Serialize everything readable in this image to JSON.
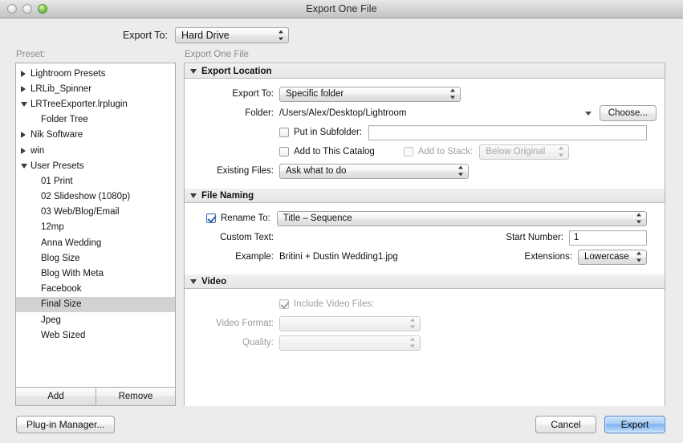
{
  "window": {
    "title": "Export One File",
    "traffic_lights": [
      "close",
      "minimize",
      "zoom"
    ]
  },
  "topbar": {
    "label": "Export To:",
    "value": "Hard Drive"
  },
  "sidebar": {
    "caption": "Preset:",
    "items": [
      {
        "label": "Lightroom Presets",
        "type": "group",
        "expanded": false,
        "selected": false
      },
      {
        "label": "LRLib_Spinner",
        "type": "group",
        "expanded": false,
        "selected": false
      },
      {
        "label": "LRTreeExporter.lrplugin",
        "type": "group",
        "expanded": true,
        "selected": false
      },
      {
        "label": "Folder Tree",
        "type": "child",
        "selected": false
      },
      {
        "label": "Nik Software",
        "type": "group",
        "expanded": false,
        "selected": false
      },
      {
        "label": "win",
        "type": "group",
        "expanded": false,
        "selected": false
      },
      {
        "label": "User Presets",
        "type": "group",
        "expanded": true,
        "selected": false
      },
      {
        "label": "01 Print",
        "type": "child",
        "selected": false
      },
      {
        "label": "02 Slideshow (1080p)",
        "type": "child",
        "selected": false
      },
      {
        "label": "03 Web/Blog/Email",
        "type": "child",
        "selected": false
      },
      {
        "label": "12mp",
        "type": "child",
        "selected": false
      },
      {
        "label": "Anna Wedding",
        "type": "child",
        "selected": false
      },
      {
        "label": "Blog Size",
        "type": "child",
        "selected": false
      },
      {
        "label": "Blog With Meta",
        "type": "child",
        "selected": false
      },
      {
        "label": "Facebook",
        "type": "child",
        "selected": false
      },
      {
        "label": "Final Size",
        "type": "child",
        "selected": true
      },
      {
        "label": "Jpeg",
        "type": "child",
        "selected": false
      },
      {
        "label": "Web Sized",
        "type": "child",
        "selected": false
      }
    ],
    "add_label": "Add",
    "remove_label": "Remove"
  },
  "main": {
    "caption": "Export One File",
    "sections": [
      {
        "id": "export_location",
        "title": "Export Location",
        "expanded": true,
        "rows": {
          "export_to_label": "Export To:",
          "export_to_value": "Specific folder",
          "folder_label": "Folder:",
          "folder_value": "/Users/Alex/Desktop/Lightroom",
          "choose_label": "Choose...",
          "put_in_subfolder_label": "Put in Subfolder:",
          "put_in_subfolder_checked": false,
          "put_in_subfolder_value": "",
          "add_to_catalog_label": "Add to This Catalog",
          "add_to_catalog_checked": false,
          "add_to_stack_label": "Add to Stack:",
          "add_to_stack_checked": false,
          "add_to_stack_value": "Below Original",
          "existing_files_label": "Existing Files:",
          "existing_files_value": "Ask what to do"
        }
      },
      {
        "id": "file_naming",
        "title": "File Naming",
        "expanded": true,
        "rows": {
          "rename_to_label": "Rename To:",
          "rename_to_checked": true,
          "rename_to_value": "Title – Sequence",
          "custom_text_label": "Custom Text:",
          "custom_text_value": "",
          "start_number_label": "Start Number:",
          "start_number_value": "1",
          "example_label": "Example:",
          "example_value": "Britini + Dustin Wedding1.jpg",
          "extensions_label": "Extensions:",
          "extensions_value": "Lowercase"
        }
      },
      {
        "id": "video",
        "title": "Video",
        "expanded": true,
        "rows": {
          "include_video_label": "Include Video Files:",
          "include_video_checked": true,
          "video_format_label": "Video Format:",
          "video_format_value": "",
          "quality_label": "Quality:",
          "quality_value": ""
        }
      }
    ]
  },
  "footer": {
    "plugin_manager_label": "Plug-in Manager...",
    "cancel_label": "Cancel",
    "export_label": "Export"
  },
  "colors": {
    "accent": "#7fb3ef",
    "selection": "#d2d2d2",
    "checkbox_check": "#2c62b5",
    "zoom_light": "#86cc52",
    "window_bg": "#ececec",
    "panel_bg": "#ffffff"
  }
}
